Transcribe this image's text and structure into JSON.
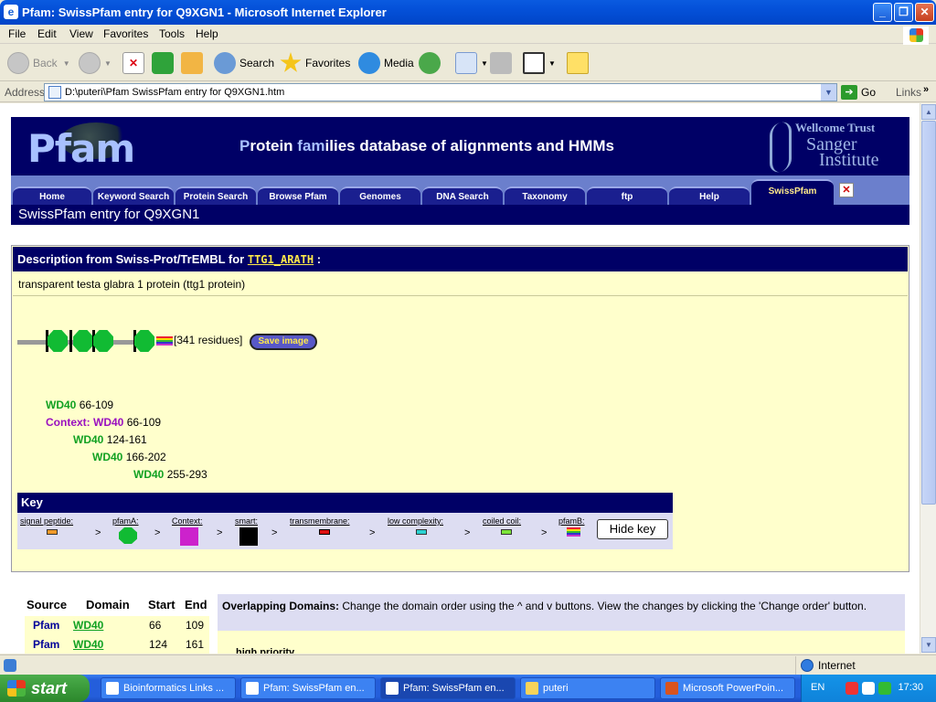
{
  "window": {
    "title": "Pfam: SwissPfam entry for Q9XGN1 - Microsoft Internet Explorer",
    "app_icon": "e"
  },
  "menu": [
    "File",
    "Edit",
    "View",
    "Favorites",
    "Tools",
    "Help"
  ],
  "toolbar": {
    "back": "Back",
    "search": "Search",
    "favorites": "Favorites",
    "media": "Media"
  },
  "address": {
    "label": "Address",
    "url": "D:\\puteri\\Pfam SwissPfam entry for Q9XGN1.htm",
    "go": "Go",
    "links": "Links"
  },
  "page": {
    "banner_title_p": "P",
    "banner_title_rotein": "rotein ",
    "banner_title_fam": "fam",
    "banner_title_rest": "ilies database of alignments and HMMs",
    "logo_word": "Pfam",
    "sanger_line1": "Wellcome Trust",
    "sanger_line2": "Sanger",
    "sanger_line3": "Institute",
    "nav": [
      "Home",
      "Keyword Search",
      "Protein Search",
      "Browse Pfam",
      "Genomes",
      "DNA Search",
      "Taxonomy",
      "ftp",
      "Help",
      "SwissPfam"
    ],
    "subtitle": "SwissPfam entry for Q9XGN1",
    "desc_head_prefix": "Description from Swiss-Prot/TrEMBL for ",
    "desc_head_link": "TTG1_ARATH",
    "desc_head_suffix": " :",
    "desc_text": "transparent testa glabra 1 protein (ttg1 protein)",
    "residues": "[341 residues]",
    "save_image": "Save image",
    "domains": [
      {
        "label": "",
        "name": "WD40",
        "range": "66-109"
      },
      {
        "label": "Context: ",
        "name": "WD40",
        "range": "66-109"
      },
      {
        "label": "",
        "name": "WD40",
        "range": "124-161"
      },
      {
        "label": "",
        "name": "WD40",
        "range": "166-202"
      },
      {
        "label": "",
        "name": "WD40",
        "range": "255-293"
      }
    ],
    "key": {
      "title": "Key",
      "items": [
        "signal peptide:",
        "pfamA:",
        "Context:",
        "smart:",
        "transmembrane:",
        "low complexity:",
        "coiled coil:",
        "pfamB:"
      ],
      "arrow": ">",
      "hide": "Hide key"
    },
    "table": {
      "headers": [
        "Source",
        "Domain",
        "Start",
        "End"
      ],
      "rows": [
        {
          "source": "Pfam",
          "domain": "WD40",
          "start": "66",
          "end": "109"
        },
        {
          "source": "Pfam",
          "domain": "WD40",
          "start": "124",
          "end": "161"
        }
      ]
    },
    "overlap": {
      "bold": "Overlapping Domains:",
      "text": " Change the domain order using the ^ and v buttons. View the changes by clicking the 'Change order' button.",
      "priority": "high priority"
    }
  },
  "status": {
    "zone": "Internet"
  },
  "taskbar": {
    "start": "start",
    "tasks": [
      "Bioinformatics Links ...",
      "Pfam: SwissPfam en...",
      "Pfam: SwissPfam en...",
      "puteri",
      "Microsoft PowerPoin..."
    ],
    "lang": "EN",
    "clock": "17:30"
  },
  "colors": {
    "pfam_navy": "#000066",
    "domain_green": "#11bb33",
    "context_purple": "#9a10c0",
    "page_yellow": "#ffffcc"
  }
}
